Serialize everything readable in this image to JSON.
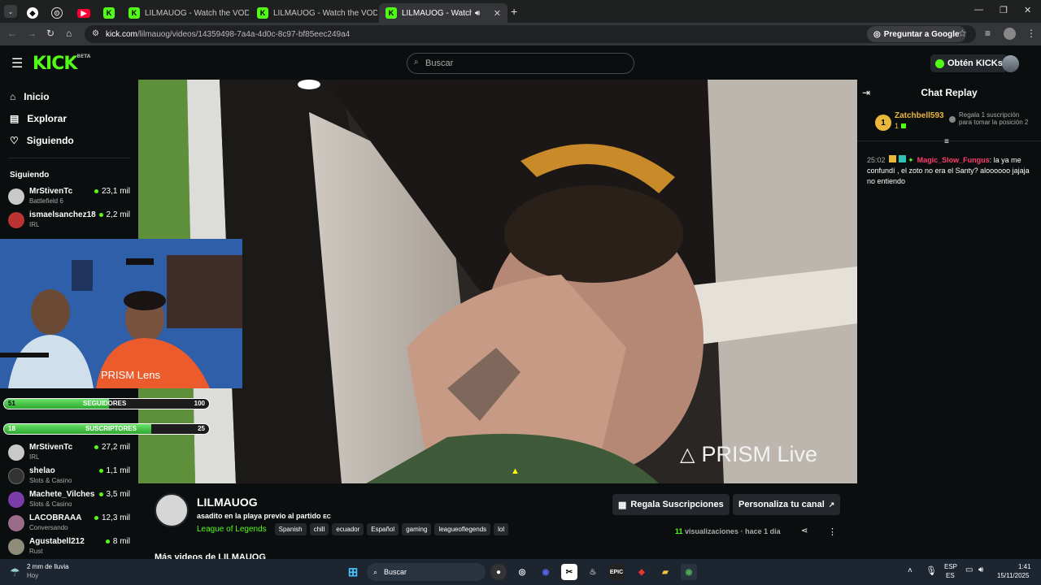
{
  "browser": {
    "tabs": [
      {
        "label": ""
      },
      {
        "label": ""
      },
      {
        "label": ""
      },
      {
        "label": ""
      },
      {
        "label": "K"
      },
      {
        "label": "LILMAUOG - Watch the VOD o"
      },
      {
        "label": "LILMAUOG - Watch the VOD o"
      },
      {
        "label": "LILMAUOG - Watch the VOD"
      }
    ],
    "url_domain": "kick.com",
    "url_path": "/lilmauog/videos/14359498-7a4a-4d0c-8c97-bf85eec249a4",
    "ask_google": "Preguntar a Google"
  },
  "header": {
    "logo": "KICK",
    "logo_badge": "BETA",
    "search_placeholder": "Buscar",
    "get_kicks": "Obtén KICKs",
    "accent": "#53fc18"
  },
  "sidebar": {
    "nav": [
      "Inicio",
      "Explorar",
      "Siguiendo"
    ],
    "following_title": "Siguiendo",
    "following_top": [
      {
        "name": "MrStivenTc",
        "category": "Battlefield 6",
        "viewers": "23,1 mil"
      },
      {
        "name": "ismaelsanchez18",
        "category": "IRL",
        "viewers": "2,2 mil"
      }
    ],
    "following_bottom": [
      {
        "name": "MrStivenTc",
        "category": "IRL",
        "viewers": "27,2 mil"
      },
      {
        "name": "shelao",
        "category": "Slots & Casino",
        "viewers": "1,1 mil"
      },
      {
        "name": "Machete_Vilches",
        "category": "Slots & Casino",
        "viewers": "3,5 mil"
      },
      {
        "name": "LACOBRAAA",
        "category": "Conversando",
        "viewers": "12,3 mil"
      },
      {
        "name": "Agustabell212",
        "category": "Rust",
        "viewers": "8 mil"
      }
    ]
  },
  "overlay": {
    "prism_lens": "PRISM Lens",
    "followers_bar": {
      "current": "51",
      "label": "SEGUIDORES",
      "goal": "100",
      "progress": 0.51
    },
    "subs_bar": {
      "current": "18",
      "label": "SUSCRIPTORES",
      "goal": "25",
      "progress": 0.72
    }
  },
  "video": {
    "watermark": "PRISM Live"
  },
  "chat": {
    "title": "Chat Replay",
    "leader_rank": "1",
    "leader_name": "Zatchbell593",
    "leader_count": "1",
    "gift_text": "Regala 1 suscripción para tomar la posición 2",
    "messages": [
      {
        "time": "25:02",
        "user": "Magic_Slow_Fungus",
        "text": ": la ya me confundí , el zoto no era el Santy? aloooooo jajaja no entiendo"
      }
    ]
  },
  "stream_info": {
    "channel": "LILMAUOG",
    "title": "asadito en la playa previo al partido",
    "title_flag": "EC",
    "category": "League of Legends",
    "tags": [
      "Spanish",
      "chill",
      "ecuador",
      "Español",
      "gaming",
      "leagueoflegends",
      "lol"
    ],
    "gift_subs_button": "Regala Suscripciones",
    "customize_button": "Personaliza tu canal",
    "views_count": "11",
    "views_label": "visualizaciones",
    "time_ago": "hace 1 día",
    "more_videos": "Más videos de LILMAUOG"
  },
  "taskbar": {
    "weather_temp": "2 mm de lluvia",
    "weather_day": "Hoy",
    "search": "Buscar",
    "lang_top": "ESP",
    "lang_bottom": "ES",
    "time": "1:41",
    "date": "15/11/2025"
  }
}
